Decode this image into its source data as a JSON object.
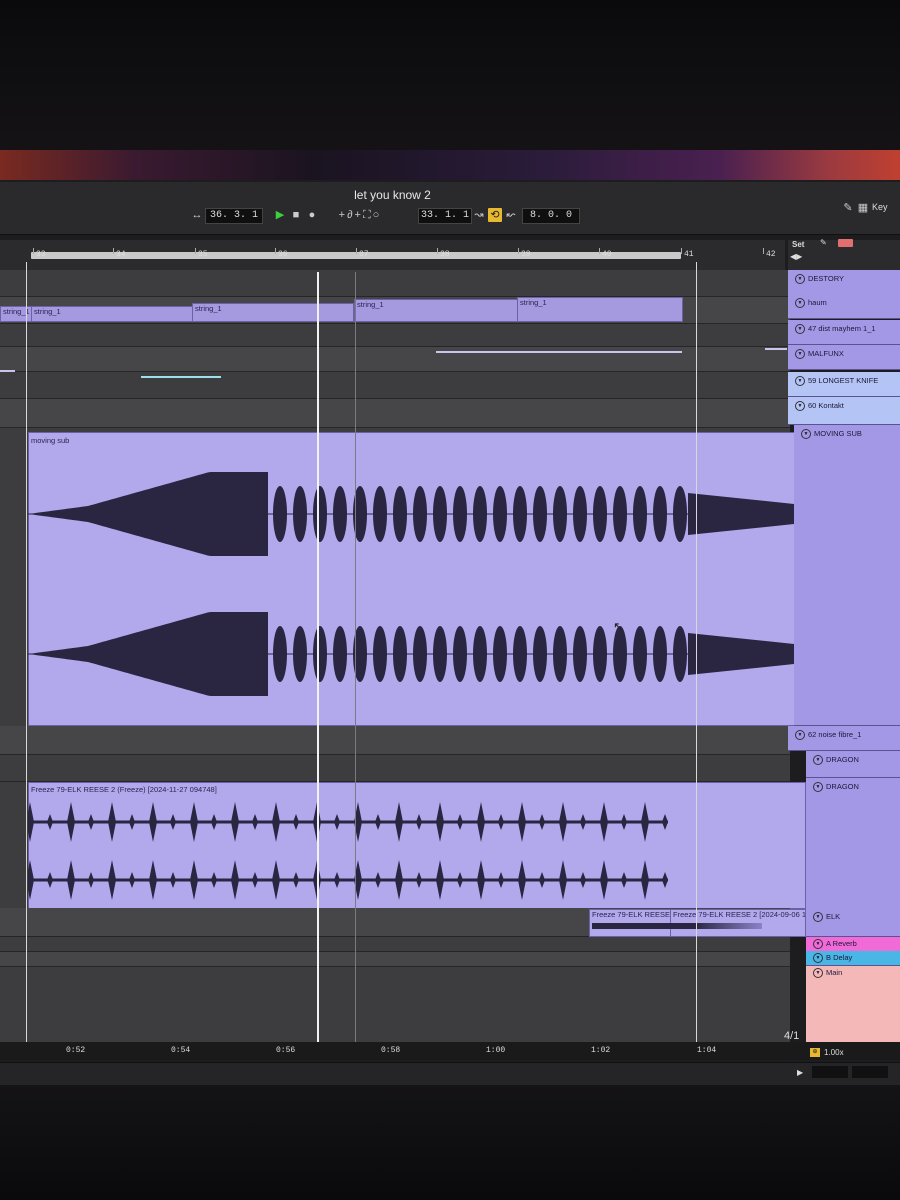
{
  "window": {
    "title": "let you know 2"
  },
  "transport": {
    "position": "36. 3. 1",
    "loop_start": "33. 1. 1",
    "loop_length": "8. 0. 0",
    "key_label": "Key"
  },
  "ruler": {
    "bars": [
      "33",
      "34",
      "35",
      "36",
      "37",
      "38",
      "39",
      "40",
      "41",
      "42"
    ]
  },
  "timecodes": [
    "0:52",
    "0:54",
    "0:56",
    "0:58",
    "1:00",
    "1:02",
    "1:04"
  ],
  "set_label": "Set",
  "clips": {
    "string_1": "string_1",
    "moving_sub": "moving sub",
    "freeze_main": "Freeze 79-ELK REESE 2 (Freeze) [2024-11-27 094748]",
    "freeze_small_1": "Freeze 79-ELK REESE",
    "freeze_small_2": "Freeze 79-ELK REESE 2 [2024-09-06 1"
  },
  "tracks": [
    {
      "name": "DESTORY",
      "color": "#a398e6"
    },
    {
      "name": "haum",
      "color": "#a398e6"
    },
    {
      "name": "47 dist mayhem 1_1",
      "color": "#a398e6"
    },
    {
      "name": "MALFUNX",
      "color": "#a398e6"
    },
    {
      "name": "59 LONGEST KNIFE",
      "color": "#b4c4f4"
    },
    {
      "name": "60 Kontakt",
      "color": "#b4c4f4"
    },
    {
      "name": "MOVING SUB",
      "color": "#a398e6"
    },
    {
      "name": "62 noise fibre_1",
      "color": "#a398e6"
    },
    {
      "name": "DRAGON",
      "color": "#a398e6"
    },
    {
      "name": "DRAGON",
      "color": "#a398e6"
    },
    {
      "name": "ELK",
      "color": "#a398e6"
    },
    {
      "name": "A Reverb",
      "color": "#f06ad8"
    },
    {
      "name": "B Delay",
      "color": "#4ab6e6"
    },
    {
      "name": "Main",
      "color": "#f4b8b8"
    }
  ],
  "status": {
    "page": "4/1",
    "zoom": "1.00x"
  },
  "icons": [
    "play-icon",
    "stop-icon",
    "record-icon",
    "loop-icon",
    "pencil-icon",
    "lock-icon",
    "fold-icon",
    "mouse-cursor-icon"
  ]
}
